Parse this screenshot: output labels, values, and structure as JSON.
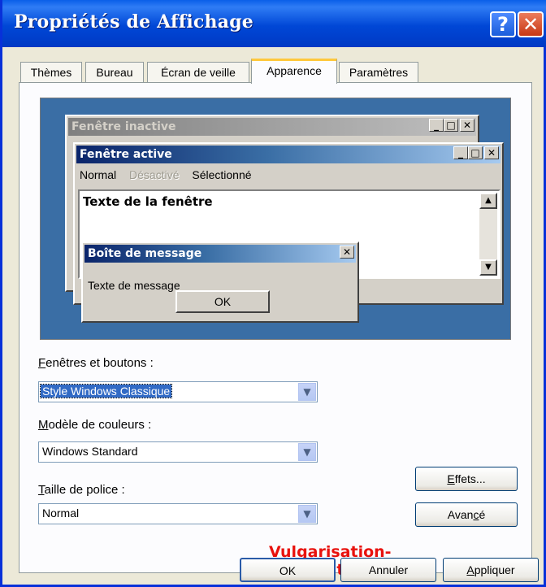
{
  "window": {
    "title": "Propriétés de Affichage",
    "help_label": "?",
    "close_label": "✕"
  },
  "tabs": [
    {
      "label": "Thèmes"
    },
    {
      "label": "Bureau"
    },
    {
      "label": "Écran de veille"
    },
    {
      "label": "Apparence",
      "active": true
    },
    {
      "label": "Paramètres"
    }
  ],
  "preview": {
    "inactive_title": "Fenêtre inactive",
    "active_title": "Fenêtre active",
    "menu": {
      "normal": "Normal",
      "disabled": "Désactivé",
      "selected": "Sélectionné"
    },
    "window_text": "Texte de la fenêtre",
    "message_box": {
      "title": "Boîte de message",
      "text": "Texte de message",
      "ok_label": "OK"
    }
  },
  "fields": {
    "windows_buttons": {
      "label_hotkey": "F",
      "label_rest": "enêtres et boutons :",
      "value": "Style Windows Classique"
    },
    "color_scheme": {
      "label_hotkey": "M",
      "label_rest": "odèle de couleurs :",
      "value": "Windows Standard"
    },
    "font_size": {
      "label_hotkey": "T",
      "label_rest": "aille de police :",
      "value": "Normal"
    }
  },
  "buttons": {
    "effects_hotkey": "E",
    "effects_rest": "ffets...",
    "advanced_pre": "Avan",
    "advanced_hotkey": "c",
    "advanced_post": "é",
    "ok": "OK",
    "cancel": "Annuler",
    "apply_hotkey": "A",
    "apply_rest": "ppliquer"
  },
  "watermark": "Vulgarisation-informatique.com",
  "colors": {
    "xp_title_blue": "#0047d6",
    "classic_active_title": "#0a246a",
    "desktop_preview": "#3a6ea5",
    "watermark_red": "#e8120e"
  }
}
